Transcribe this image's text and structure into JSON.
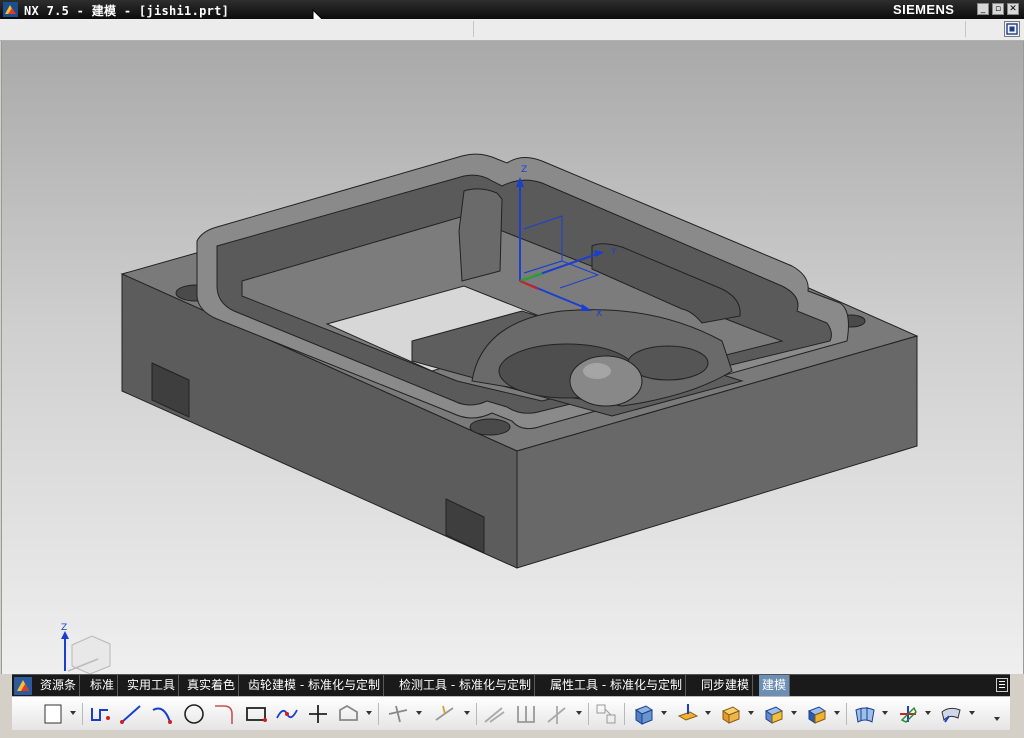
{
  "window": {
    "title": "NX 7.5 - 建模 - [jishi1.prt]",
    "brand": "SIEMENS",
    "controls": [
      "minimize",
      "restore",
      "close"
    ]
  },
  "viewport": {
    "background_top": "#a9a9a9",
    "background_bottom": "#efefef",
    "model_color": "#6e6e6e",
    "csys_axes": [
      "Z",
      "Y",
      "X"
    ],
    "triad_axes": [
      "Z"
    ]
  },
  "toolbar_tabs": [
    {
      "label": "资源条",
      "active": false
    },
    {
      "label": "标准",
      "active": false
    },
    {
      "label": "实用工具",
      "active": false
    },
    {
      "label": "真实着色",
      "active": false
    },
    {
      "label": "齿轮建模 - 标准化与定制",
      "active": false
    },
    {
      "label": "检测工具 - 标准化与定制",
      "active": false
    },
    {
      "label": "属性工具 - 标准化与定制",
      "active": false
    },
    {
      "label": "同步建模",
      "active": false
    },
    {
      "label": "建模",
      "active": true
    }
  ],
  "toolbar_icons": [
    "settings-icon",
    "sketch-plane-icon",
    "profile-icon",
    "line-icon",
    "arc-icon",
    "circle-icon",
    "fillet-curve-icon",
    "rectangle-icon",
    "studio-spline-icon",
    "point-icon",
    "offset-curve-icon",
    "trim-curve-icon",
    "extend-curve-icon",
    "project-curve-icon",
    "extract-curve-icon",
    "mirror-curve-icon",
    "edit-curve-icon",
    "extrude-icon",
    "datum-plane-icon",
    "block-icon",
    "edge-blend-icon",
    "unite-icon",
    "through-curves-icon",
    "transform-icon",
    "sweep-icon"
  ],
  "colors": {
    "titlebar": "#1a1a1a",
    "tab_active": "#6e8fb4",
    "axis_z": "#1a3fd0",
    "axis_y": "#1a3fd0",
    "axis_x": "#1a3fd0"
  }
}
